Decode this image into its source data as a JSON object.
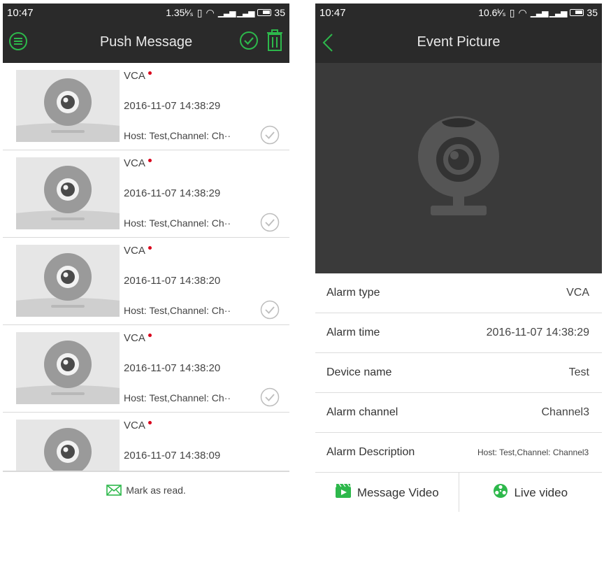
{
  "left": {
    "status": {
      "time": "10:47",
      "speed": "1.35",
      "battery": "35"
    },
    "title": "Push Message",
    "messages": [
      {
        "type": "VCA",
        "time": "2016-11-07 14:38:29",
        "host": "Host: Test,Channel: Ch··"
      },
      {
        "type": "VCA",
        "time": "2016-11-07 14:38:29",
        "host": "Host: Test,Channel: Ch··"
      },
      {
        "type": "VCA",
        "time": "2016-11-07 14:38:20",
        "host": "Host: Test,Channel: Ch··"
      },
      {
        "type": "VCA",
        "time": "2016-11-07 14:38:20",
        "host": "Host: Test,Channel: Ch··"
      },
      {
        "type": "VCA",
        "time": "2016-11-07 14:38:09",
        "host": ""
      }
    ],
    "mark_read": "Mark as read."
  },
  "right": {
    "status": {
      "time": "10:47",
      "speed": "10.6",
      "battery": "35"
    },
    "title": "Event Picture",
    "rows": [
      {
        "label": "Alarm type",
        "value": "VCA"
      },
      {
        "label": "Alarm time",
        "value": "2016-11-07 14:38:29"
      },
      {
        "label": "Device name",
        "value": "Test"
      },
      {
        "label": "Alarm channel",
        "value": "Channel3"
      },
      {
        "label": "Alarm Description",
        "value": "Host: Test,Channel: Channel3"
      }
    ],
    "actions": {
      "message_video": "Message Video",
      "live_video": "Live video"
    }
  },
  "colors": {
    "accent": "#2db84b",
    "unread_dot": "#d9001b",
    "bar": "#2a2a2a"
  }
}
